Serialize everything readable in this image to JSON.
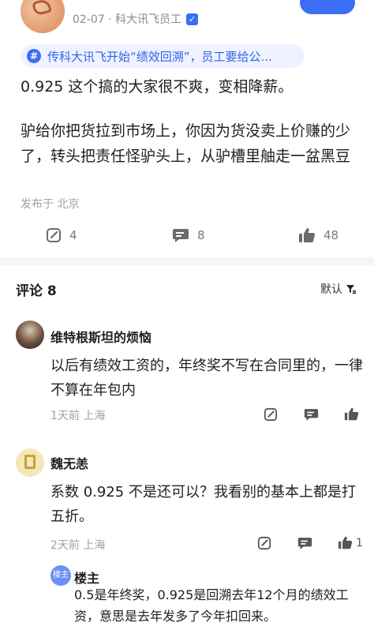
{
  "post": {
    "meta": "02-07 · 科大讯飞员工",
    "topic": "传科大讯飞开始“绩效回溯”，员工要给公...",
    "body_p1": "0.925 这个搞的大家很不爽，变相降薪。",
    "body_p2": "驴给你把货拉到市场上，你因为货没卖上价赚的少了，转头把责任怪驴头上，从驴槽里舳走一盆黑豆",
    "location": "发布于 北京",
    "actions": {
      "repost_count": "4",
      "comment_count": "8",
      "like_count": "48"
    }
  },
  "comments_header": {
    "title": "评论 8",
    "sort_label": "默认"
  },
  "comments": [
    {
      "name": "维特根斯坦的烦恼",
      "text": "以后有绩效工资的，年终奖不写在合同里的，一律不算在年包内",
      "meta": "1天前 上海",
      "like_count": ""
    },
    {
      "name": "魏无恙",
      "text": "系数 0.925 不是还可以？我看别的基本上都是打五折。",
      "meta": "2天前 上海",
      "like_count": "1"
    }
  ],
  "reply": {
    "badge": "楼主",
    "name": "楼主",
    "text": "0.5是年终奖，0.925是回溯去年12个月的绩效工资，意思是去年发多了今年扣回来。"
  },
  "colors": {
    "accent": "#3b6ef5",
    "topic_bg": "#eef3ff",
    "muted": "#a0a0a0"
  }
}
